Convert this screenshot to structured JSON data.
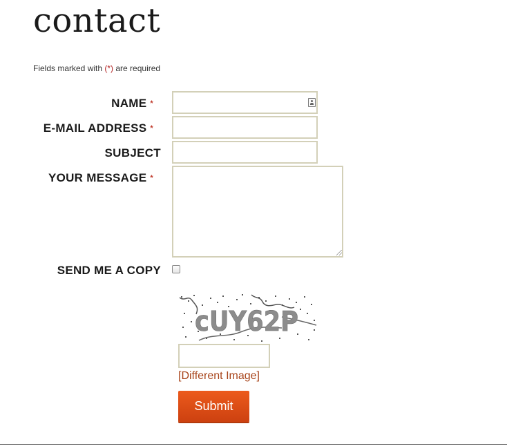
{
  "page": {
    "title": "contact"
  },
  "form": {
    "required_note": {
      "prefix": "Fields marked with ",
      "marker": "(*)",
      "suffix": " are required"
    },
    "required_marker": "*",
    "fields": {
      "name": {
        "label": "NAME",
        "value": ""
      },
      "email": {
        "label": "E-MAIL ADDRESS",
        "value": ""
      },
      "subject": {
        "label": "SUBJECT",
        "value": ""
      },
      "message": {
        "label": "YOUR MESSAGE",
        "value": ""
      },
      "copy": {
        "label": "SEND ME A COPY",
        "checked": false
      }
    },
    "captcha": {
      "text": "cUY62P",
      "input_value": "",
      "refresh_label": "[Different Image]"
    },
    "submit_label": "Submit"
  },
  "colors": {
    "accent": "#d94a14",
    "link": "#a8441a",
    "required": "#c0392b",
    "input_border": "#d3d0b8"
  }
}
